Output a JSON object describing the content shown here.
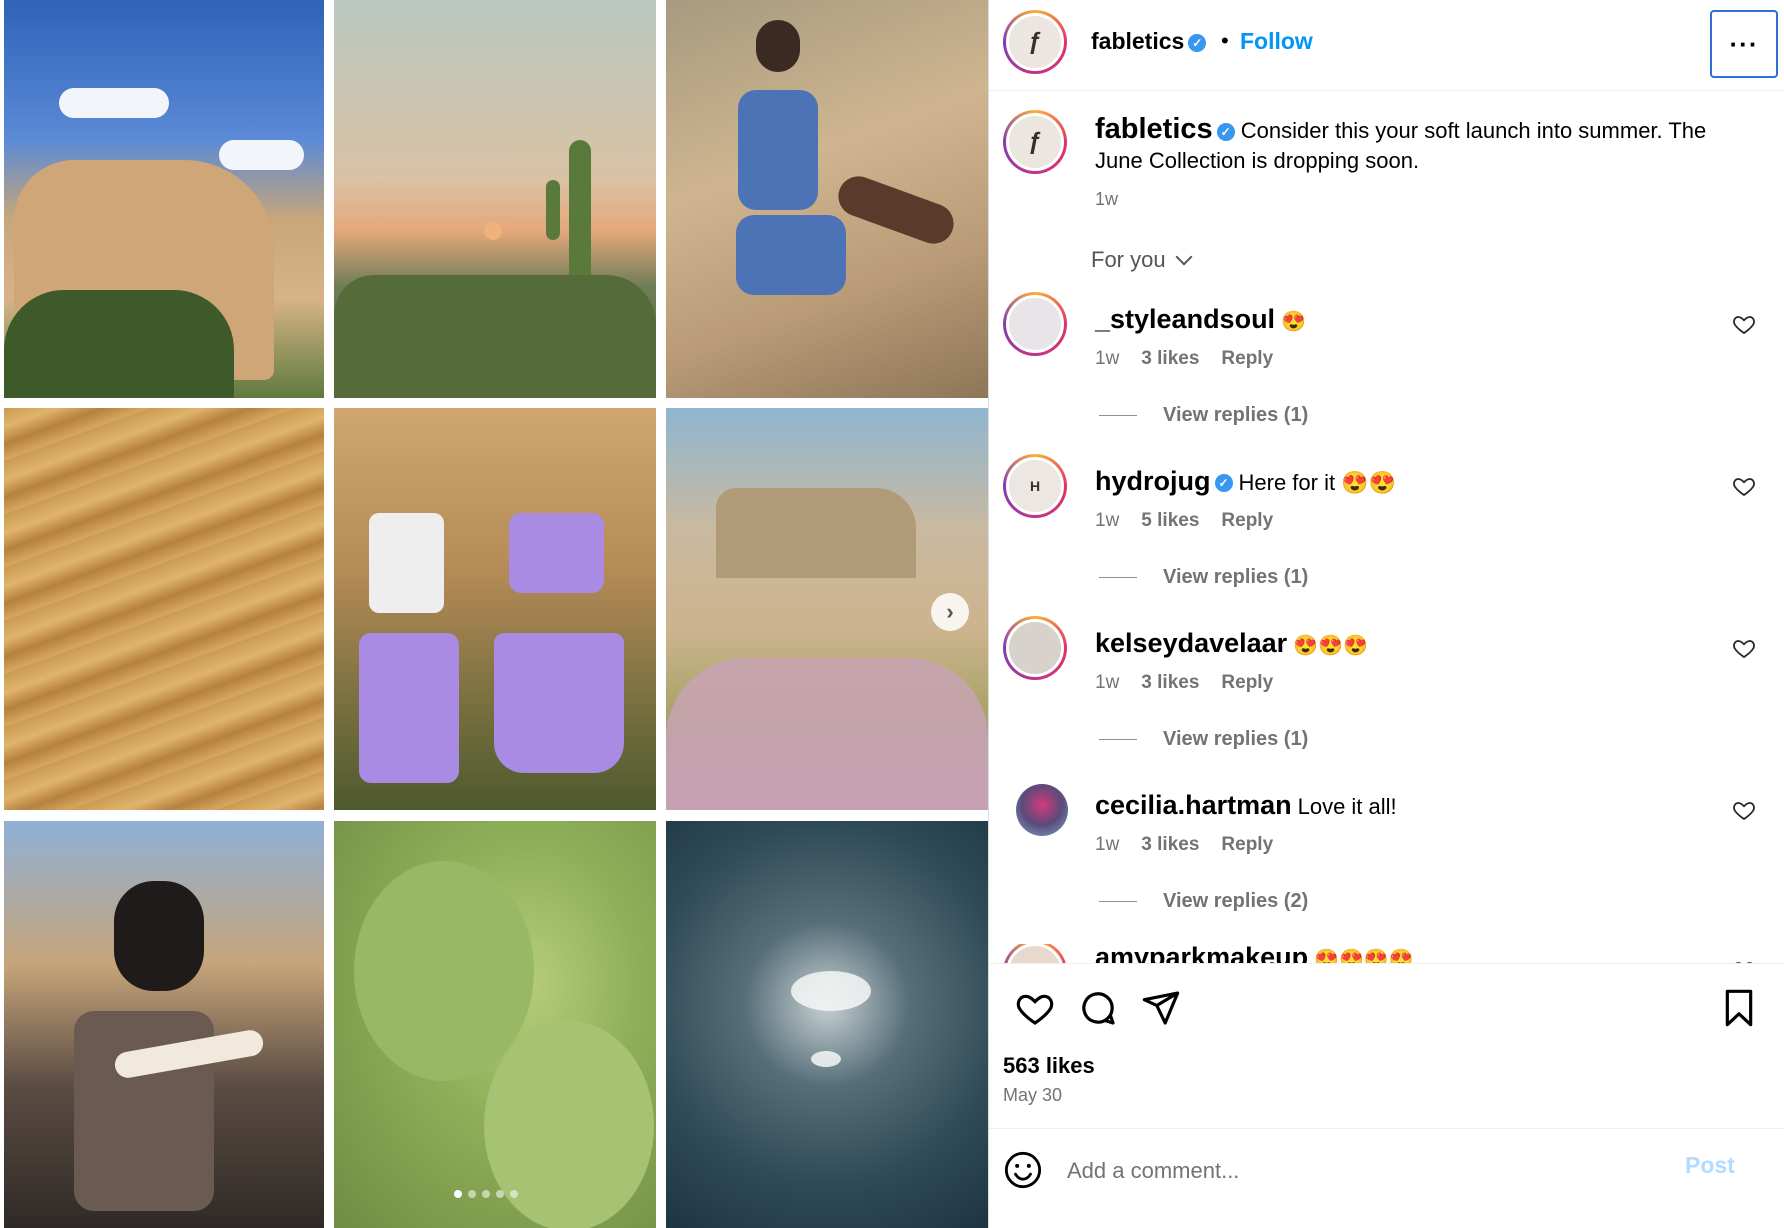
{
  "post": {
    "account": "fabletics",
    "follow_label": "Follow",
    "separator": "•",
    "more_label": "···",
    "caption": "Consider this your soft launch into summer. The June Collection is dropping soon.",
    "caption_time": "1w",
    "sort_label": "For you",
    "likes": "563 likes",
    "date": "May 30",
    "add_comment_placeholder": "Add a comment...",
    "post_label": "Post"
  },
  "comments": [
    {
      "user": "_styleandsoul",
      "text": "😍",
      "time": "1w",
      "likes": "3 likes",
      "reply": "Reply",
      "replies": "View replies (1)",
      "verified": false
    },
    {
      "user": "hydrojug",
      "text": "Here for it 😍😍",
      "time": "1w",
      "likes": "5 likes",
      "reply": "Reply",
      "replies": "View replies (1)",
      "verified": true
    },
    {
      "user": "kelseydavelaar",
      "text": "😍😍😍",
      "time": "1w",
      "likes": "3 likes",
      "reply": "Reply",
      "replies": "View replies (1)",
      "verified": false
    },
    {
      "user": "cecilia.hartman",
      "text": "Love it all!",
      "time": "1w",
      "likes": "3 likes",
      "reply": "Reply",
      "replies": "View replies (2)",
      "verified": false
    },
    {
      "user": "amyparkmakeup",
      "text": "😍😍😍😍",
      "time": "",
      "likes": "",
      "reply": "",
      "replies": "",
      "verified": false
    }
  ],
  "carousel": {
    "slide_count": 5,
    "active_slide": 1
  },
  "colors": {
    "accent": "#0095f6",
    "verified": "#3897f0",
    "muted": "#737373",
    "post_disabled": "#b3dbff"
  },
  "icons": [
    "verified-badge-icon",
    "more-options-icon",
    "chevron-down-icon",
    "heart-icon",
    "comment-icon",
    "share-icon",
    "bookmark-icon",
    "emoji-icon",
    "next-arrow-icon"
  ]
}
